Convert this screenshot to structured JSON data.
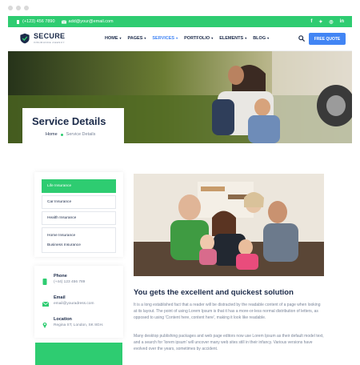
{
  "topbar": {
    "phone": "(+123) 456 7890",
    "email": "add@your@email.com",
    "social_icons": [
      "facebook-icon",
      "twitter-icon",
      "instagram-icon",
      "linkedin-icon"
    ]
  },
  "brand": {
    "name": "SECURE",
    "tagline": "INSURANCE AGENCY"
  },
  "nav": {
    "items": [
      {
        "label": "HOME",
        "active": false
      },
      {
        "label": "PAGES",
        "active": false
      },
      {
        "label": "SERVICES",
        "active": true
      },
      {
        "label": "PORTFOLIO",
        "active": false
      },
      {
        "label": "ELEMENTS",
        "active": false
      },
      {
        "label": "BLOG",
        "active": false
      }
    ],
    "cta": "FREE QUOTE"
  },
  "hero": {
    "title": "Service Details",
    "breadcrumb_home": "Home",
    "breadcrumb_current": "Service Details"
  },
  "services": {
    "items": [
      "Life Insurance",
      "Car Insurance",
      "Health Insurance"
    ],
    "grouped": [
      "Home Insurance",
      "Business Insurance"
    ]
  },
  "contact": {
    "phone_label": "Phone",
    "phone_value": "(+44) 123 456 789",
    "email_label": "Email",
    "email_value": "email@youradress.com",
    "location_label": "Location",
    "location_value": "Regina ST, London, SK 8GH."
  },
  "content": {
    "heading": "You gets the excellent and quickest solution",
    "p1": "It is a long established fact that a reader will be distracted by the readable content of a page when looking at its layout. The point of using Lorem Ipsum is that it has a more-or-less normal distribution of letters, as opposed to using 'Content here, content here', making it look like readable.",
    "p2": "Many desktop publishing packages and web page editors now use Lorem Ipsum as their default model text, and a search for 'lorem ipsum' will uncover many web sites still in their infancy. Various versions have evolved over the years, sometimes by accident."
  },
  "colors": {
    "green": "#2ecc71",
    "blue": "#4285f4",
    "navy": "#1c2b4a"
  }
}
